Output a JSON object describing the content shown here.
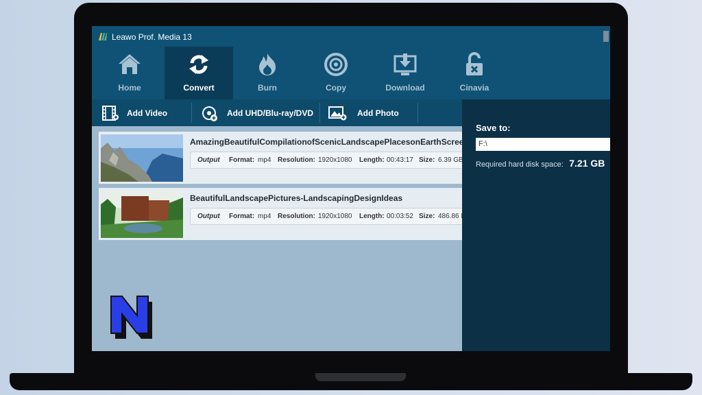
{
  "app": {
    "title": "Leawo Prof. Media 13"
  },
  "toolbar": {
    "items": [
      {
        "label": "Home",
        "icon": "home-icon",
        "active": false
      },
      {
        "label": "Convert",
        "icon": "convert-icon",
        "active": true
      },
      {
        "label": "Burn",
        "icon": "fire-icon",
        "active": false
      },
      {
        "label": "Copy",
        "icon": "disc-icon",
        "active": false
      },
      {
        "label": "Download",
        "icon": "download-icon",
        "active": false
      },
      {
        "label": "Cinavia",
        "icon": "unlock-icon",
        "active": false
      }
    ]
  },
  "subtoolbar": {
    "add_video": "Add Video",
    "add_uhd": "Add UHD/Blu-ray/DVD",
    "add_photo": "Add Photo"
  },
  "files": [
    {
      "name": "AmazingBeautifulCompilationofScenicLandscapePlacesonEarthScreenS",
      "output_label": "Output",
      "format_label": "Format:",
      "format": "mp4",
      "resolution_label": "Resolution:",
      "resolution": "1920x1080",
      "length_label": "Length:",
      "length": "00:43:17",
      "size_label": "Size:",
      "size": "6.39 GB"
    },
    {
      "name": "BeautifulLandscapePictures-LandscapingDesignIdeas",
      "output_label": "Output",
      "format_label": "Format:",
      "format": "mp4",
      "resolution_label": "Resolution:",
      "resolution": "1920x1080",
      "length_label": "Length:",
      "length": "00:03:52",
      "size_label": "Size:",
      "size": "486.86 I"
    }
  ],
  "save_panel": {
    "save_to_label": "Save to:",
    "save_path": "F:\\",
    "disk_label": "Required hard disk space:",
    "disk_value": "7.21 GB",
    "disk_extra": "F"
  },
  "colors": {
    "toolbar_bg": "#0f5275",
    "active_tab_bg": "#0b3c57",
    "panel_bg": "#0c3046",
    "list_bg": "#9eb8cd"
  }
}
